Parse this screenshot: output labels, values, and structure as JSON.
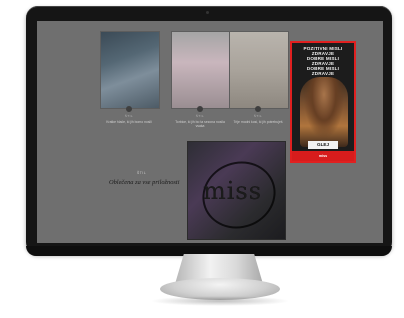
{
  "screen": {
    "cards": [
      {
        "tag": "ŠTIL",
        "title": "Kratke hlače, ki jih bomo nosili"
      },
      {
        "tag": "ŠTIL",
        "title": "Torbice, ki jih bo ta sezona nosila vsaka"
      },
      {
        "tag": "ŠTIL",
        "title": "Trije modni kosi, ki jih potrebuješ"
      }
    ],
    "ad": {
      "lines": [
        "POZITIVNI MISLI",
        "ZDRAVJE",
        "DOBRE MISLI",
        "ZDRAVJE",
        "DOBRE MISLI",
        "ZDRAVJE"
      ],
      "cta": "GLEJ",
      "strip": "miss"
    },
    "bottom": {
      "tag": "ŠTIL",
      "title": "Oblečena za vse priložnosti"
    },
    "promo": {
      "brand": "miss"
    }
  }
}
